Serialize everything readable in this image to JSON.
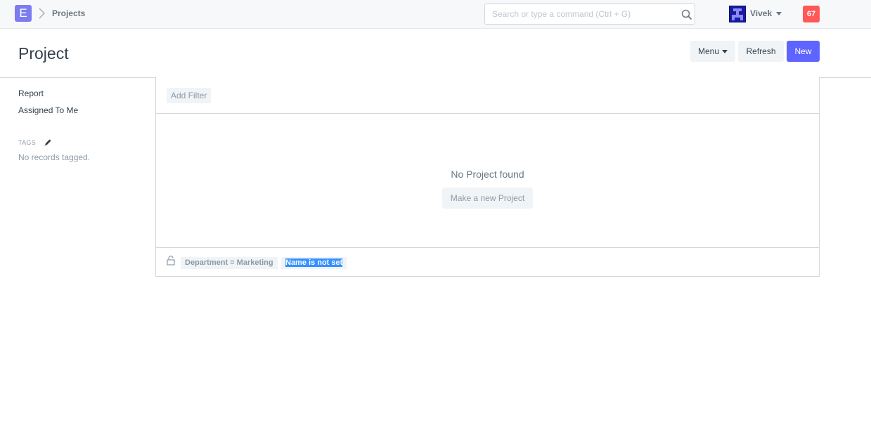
{
  "navbar": {
    "logo_letter": "E",
    "breadcrumb": "Projects",
    "search_placeholder": "Search or type a command (Ctrl + G)",
    "user_name": "Vivek",
    "notification_count": "67"
  },
  "page": {
    "title": "Project",
    "buttons": {
      "menu": "Menu",
      "refresh": "Refresh",
      "new": "New"
    }
  },
  "sidebar": {
    "links": [
      "Report",
      "Assigned To Me"
    ],
    "tags_label": "TAGS",
    "no_tags": "No records tagged."
  },
  "list": {
    "add_filter": "Add Filter",
    "empty_message": "No Project found",
    "make_new": "Make a new Project",
    "conditions": [
      "Department = Marketing",
      "Name is not set"
    ]
  },
  "colors": {
    "primary": "#5e64ff",
    "logo": "#7c7cf0",
    "notification": "#ff5858",
    "selection": "#3390ff"
  },
  "icons": {
    "breadcrumb_separator": "chevron-right-icon",
    "search": "search-icon",
    "tags_edit": "pencil-icon",
    "lock": "lock-icon"
  }
}
